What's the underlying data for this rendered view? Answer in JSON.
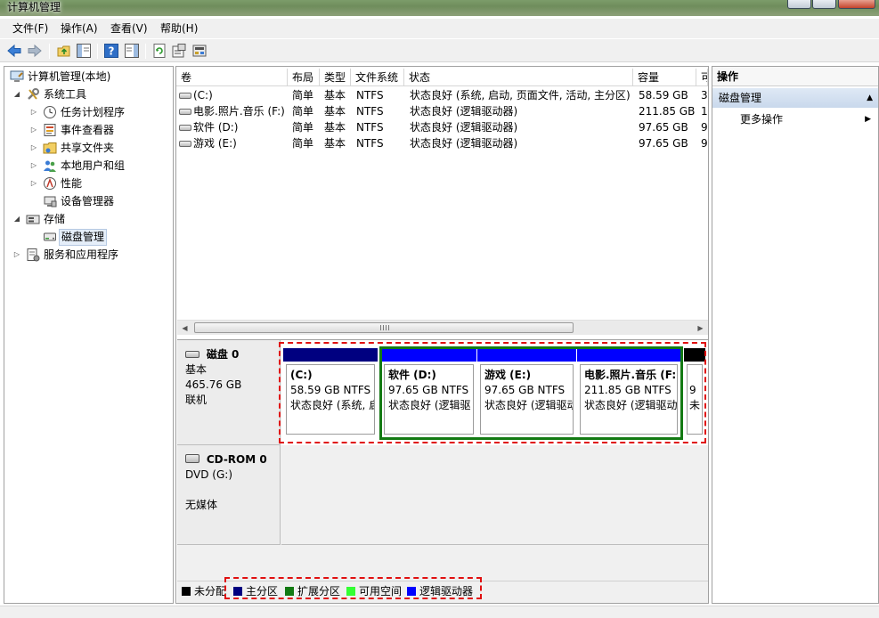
{
  "window": {
    "title": "计算机管理"
  },
  "menu": {
    "file": "文件(F)",
    "action": "操作(A)",
    "view": "查看(V)",
    "help": "帮助(H)"
  },
  "tree": {
    "root": "计算机管理(本地)",
    "system_tools": "系统工具",
    "task_scheduler": "任务计划程序",
    "event_viewer": "事件查看器",
    "shared_folders": "共享文件夹",
    "local_users": "本地用户和组",
    "performance": "性能",
    "device_manager": "设备管理器",
    "storage": "存储",
    "disk_management": "磁盘管理",
    "services_apps": "服务和应用程序"
  },
  "volumes": {
    "columns": {
      "volume": "卷",
      "layout": "布局",
      "type": "类型",
      "fs": "文件系统",
      "status": "状态",
      "capacity": "容量",
      "free": "可"
    },
    "rows": [
      {
        "name": "(C:)",
        "layout": "简单",
        "type": "基本",
        "fs": "NTFS",
        "status": "状态良好 (系统, 启动, 页面文件, 活动, 主分区)",
        "capacity": "58.59 GB",
        "free": "3"
      },
      {
        "name": "电影.照片.音乐 (F:)",
        "layout": "简单",
        "type": "基本",
        "fs": "NTFS",
        "status": "状态良好 (逻辑驱动器)",
        "capacity": "211.85 GB",
        "free": "1"
      },
      {
        "name": "软件 (D:)",
        "layout": "简单",
        "type": "基本",
        "fs": "NTFS",
        "status": "状态良好 (逻辑驱动器)",
        "capacity": "97.65 GB",
        "free": "9"
      },
      {
        "name": "游戏 (E:)",
        "layout": "简单",
        "type": "基本",
        "fs": "NTFS",
        "status": "状态良好 (逻辑驱动器)",
        "capacity": "97.65 GB",
        "free": "9"
      }
    ],
    "scroll_grip": "III"
  },
  "disk0": {
    "name": "磁盘 0",
    "kind": "基本",
    "size": "465.76 GB",
    "state": "联机",
    "partitions": [
      {
        "name": "(C:)",
        "size": "58.59 GB NTFS",
        "status": "状态良好 (系统, 启",
        "color": "#000080"
      },
      {
        "name": "软件 (D:)",
        "size": "97.65 GB NTFS",
        "status": "状态良好 (逻辑驱",
        "color": "#0000ff"
      },
      {
        "name": "游戏 (E:)",
        "size": "97.65 GB NTFS",
        "status": "状态良好 (逻辑驱动",
        "color": "#0000ff"
      },
      {
        "name": "电影.照片.音乐 (F:",
        "size": "211.85 GB NTFS",
        "status": "状态良好 (逻辑驱动",
        "color": "#0000ff"
      },
      {
        "name": "",
        "size": "9",
        "status": "未",
        "color": "#000000"
      }
    ]
  },
  "cdrom0": {
    "name": "CD-ROM 0",
    "drive": "DVD (G:)",
    "media": "无媒体"
  },
  "legend": [
    {
      "label": "未分配",
      "color": "#000000"
    },
    {
      "label": "主分区",
      "color": "#000080"
    },
    {
      "label": "扩展分区",
      "color": "#137a13"
    },
    {
      "label": "可用空间",
      "color": "#33ff33"
    },
    {
      "label": "逻辑驱动器",
      "color": "#0000ff"
    }
  ],
  "actions": {
    "header": "操作",
    "section": "磁盘管理",
    "more": "更多操作"
  }
}
